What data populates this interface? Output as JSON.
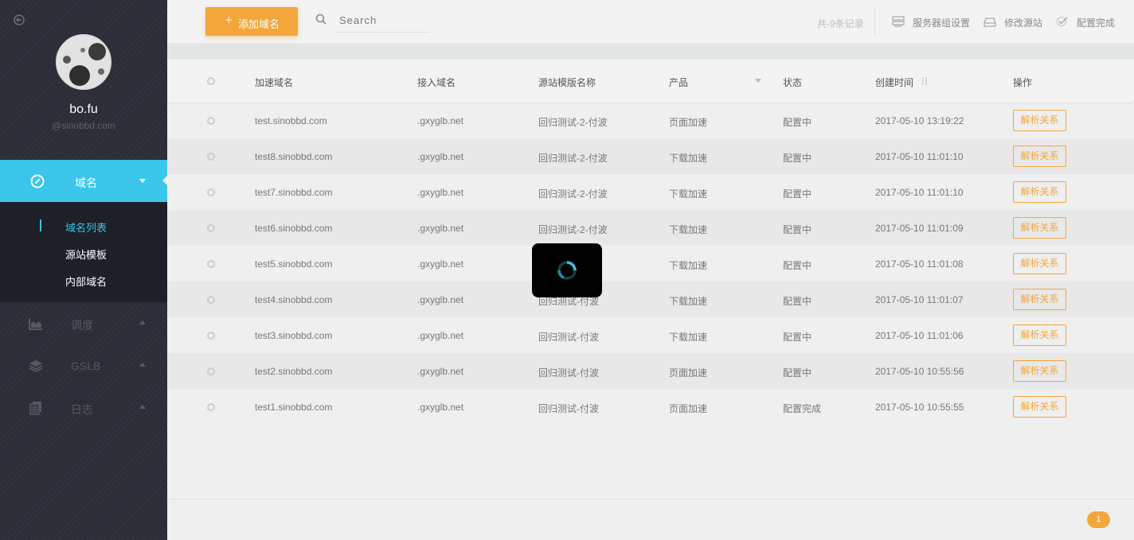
{
  "user": {
    "name": "bo.fu",
    "org": "@sinobbd.com"
  },
  "sidebar": {
    "active": {
      "label": "域名",
      "icon": "compass-icon"
    },
    "subitems": [
      {
        "label": "域名列表",
        "active": true
      },
      {
        "label": "源站模板",
        "active": false
      },
      {
        "label": "内部域名",
        "active": false
      }
    ],
    "items": [
      {
        "label": "调度",
        "icon": "area-chart-icon"
      },
      {
        "label": "GSLB",
        "icon": "layers-icon"
      },
      {
        "label": "日志",
        "icon": "documents-icon"
      }
    ]
  },
  "toolbar": {
    "add_label": "添加域名",
    "search_placeholder": "Search",
    "record_count": "共-9条记录",
    "actions": [
      {
        "label": "服务器组设置",
        "icon": "server-icon"
      },
      {
        "label": "修改源站",
        "icon": "drive-icon"
      },
      {
        "label": "配置完成",
        "icon": "check-icon"
      }
    ]
  },
  "table": {
    "headers": [
      "加速域名",
      "接入域名",
      "源站模版名称",
      "产品",
      "状态",
      "创建时间",
      "操作"
    ],
    "rows": [
      {
        "domain": "test.sinobbd.com",
        "cname": ".gxyglb.net",
        "template": "回归测试-2-付波",
        "product": "页面加速",
        "status": "配置中",
        "created": "2017-05-10 13:19:22",
        "action": "解析关系"
      },
      {
        "domain": "test8.sinobbd.com",
        "cname": ".gxyglb.net",
        "template": "回归测试-2-付波",
        "product": "下载加速",
        "status": "配置中",
        "created": "2017-05-10 11:01:10",
        "action": "解析关系"
      },
      {
        "domain": "test7.sinobbd.com",
        "cname": ".gxyglb.net",
        "template": "回归测试-2-付波",
        "product": "下载加速",
        "status": "配置中",
        "created": "2017-05-10 11:01:10",
        "action": "解析关系"
      },
      {
        "domain": "test6.sinobbd.com",
        "cname": ".gxyglb.net",
        "template": "回归测试-2-付波",
        "product": "下载加速",
        "status": "配置中",
        "created": "2017-05-10 11:01:09",
        "action": "解析关系"
      },
      {
        "domain": "test5.sinobbd.com",
        "cname": ".gxyglb.net",
        "template": "",
        "product": "下载加速",
        "status": "配置中",
        "created": "2017-05-10 11:01:08",
        "action": "解析关系"
      },
      {
        "domain": "test4.sinobbd.com",
        "cname": ".gxyglb.net",
        "template": "回归测试-付波",
        "product": "下载加速",
        "status": "配置中",
        "created": "2017-05-10 11:01:07",
        "action": "解析关系"
      },
      {
        "domain": "test3.sinobbd.com",
        "cname": ".gxyglb.net",
        "template": "回归测试-付波",
        "product": "下载加速",
        "status": "配置中",
        "created": "2017-05-10 11:01:06",
        "action": "解析关系"
      },
      {
        "domain": "test2.sinobbd.com",
        "cname": ".gxyglb.net",
        "template": "回归测试-付波",
        "product": "页面加速",
        "status": "配置中",
        "created": "2017-05-10 10:55:56",
        "action": "解析关系"
      },
      {
        "domain": "test1.sinobbd.com",
        "cname": ".gxyglb.net",
        "template": "回归测试-付波",
        "product": "页面加速",
        "status": "配置完成",
        "created": "2017-05-10 10:55:55",
        "action": "解析关系"
      }
    ]
  },
  "pagination": {
    "current": "1"
  },
  "colors": {
    "accent": "#3ac6ea",
    "brand": "#f3a63a",
    "sidebar": "#2a2d35"
  }
}
